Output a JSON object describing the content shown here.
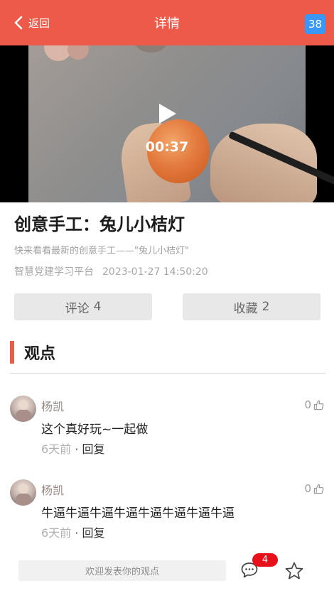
{
  "header": {
    "back_label": "返回",
    "title": "详情",
    "badge": "38",
    "color": "#ee5a49"
  },
  "video": {
    "duration": "00:37"
  },
  "article": {
    "title": "创意手工：兔儿小桔灯",
    "subtitle": "快来看看最新的创意手工——\"兔儿小桔灯\"",
    "source": "智慧党建学习平台",
    "datetime": "2023-01-27 14:50:20"
  },
  "actions": {
    "comment_label": "评论",
    "comment_count": "4",
    "favorite_label": "收藏",
    "favorite_count": "2"
  },
  "section": {
    "title": "观点"
  },
  "comments": [
    {
      "name": "杨凯",
      "text": "这个真好玩~一起做",
      "time": "6天前",
      "sep": "·",
      "reply": "回复",
      "likes": "0"
    },
    {
      "name": "杨凯",
      "text": "牛逼牛逼牛逼牛逼牛逼牛逼牛逼牛逼",
      "time": "6天前",
      "sep": "·",
      "reply": "回复",
      "likes": "0"
    }
  ],
  "bottom": {
    "input_placeholder": "欢迎发表你的观点",
    "chat_badge": "4"
  }
}
